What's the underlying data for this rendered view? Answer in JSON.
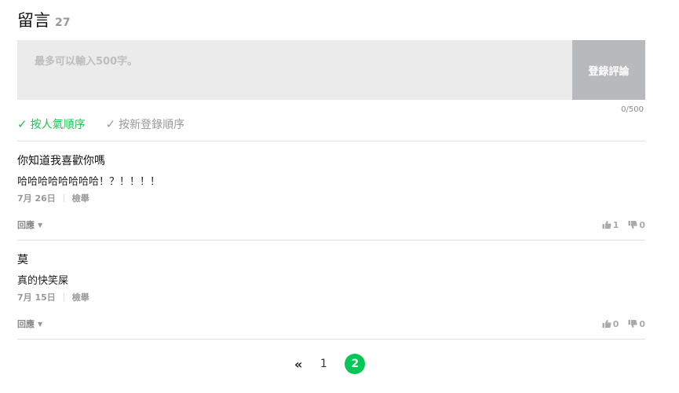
{
  "header": {
    "title": "留言",
    "count": "27"
  },
  "composer": {
    "placeholder": "最多可以輸入500字。",
    "submit_label": "登錄評論",
    "char_count": "0/500"
  },
  "sort": {
    "popular_label": "按人氣順序",
    "newest_label": "按新登錄順序"
  },
  "comments": [
    {
      "author": "你知道我喜歡你嗎",
      "text": "哈哈哈哈哈哈哈哈！？！！！！",
      "date": "7月 26日",
      "report": "檢舉",
      "reply": "回應",
      "likes": "1",
      "dislikes": "0"
    },
    {
      "author": "莫",
      "text": "真的快笑屎",
      "date": "7月 15日",
      "report": "檢舉",
      "reply": "回應",
      "likes": "0",
      "dislikes": "0"
    }
  ],
  "pagination": {
    "prev": "«",
    "pages": [
      "1",
      "2"
    ],
    "current": "2"
  },
  "colors": {
    "accent": "#1fc34f",
    "page_active": "#06c755",
    "button_gray": "#b8b9bd"
  }
}
